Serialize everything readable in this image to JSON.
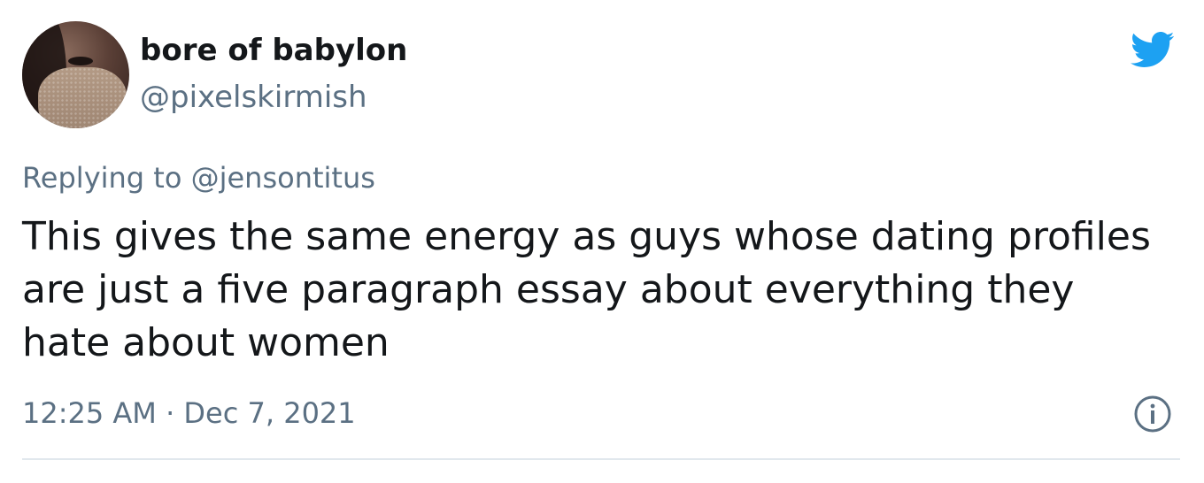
{
  "tweet": {
    "author": {
      "display_name": "bore of babylon",
      "handle": "@pixelskirmish",
      "avatar": "avatar-photo-masked-person"
    },
    "logo_icon": "twitter-bird-icon",
    "replying_to": "Replying to @jensontitus",
    "text": "This gives the same energy as guys whose dating profiles are just a five paragraph essay about everything they hate about women",
    "timestamp": "12:25 AM · Dec 7, 2021",
    "info_icon": "info-icon"
  },
  "colors": {
    "text_primary": "#14171a",
    "text_secondary": "#5b7083",
    "twitter_blue": "#1da1f2",
    "divider": "#e1e8ed"
  }
}
